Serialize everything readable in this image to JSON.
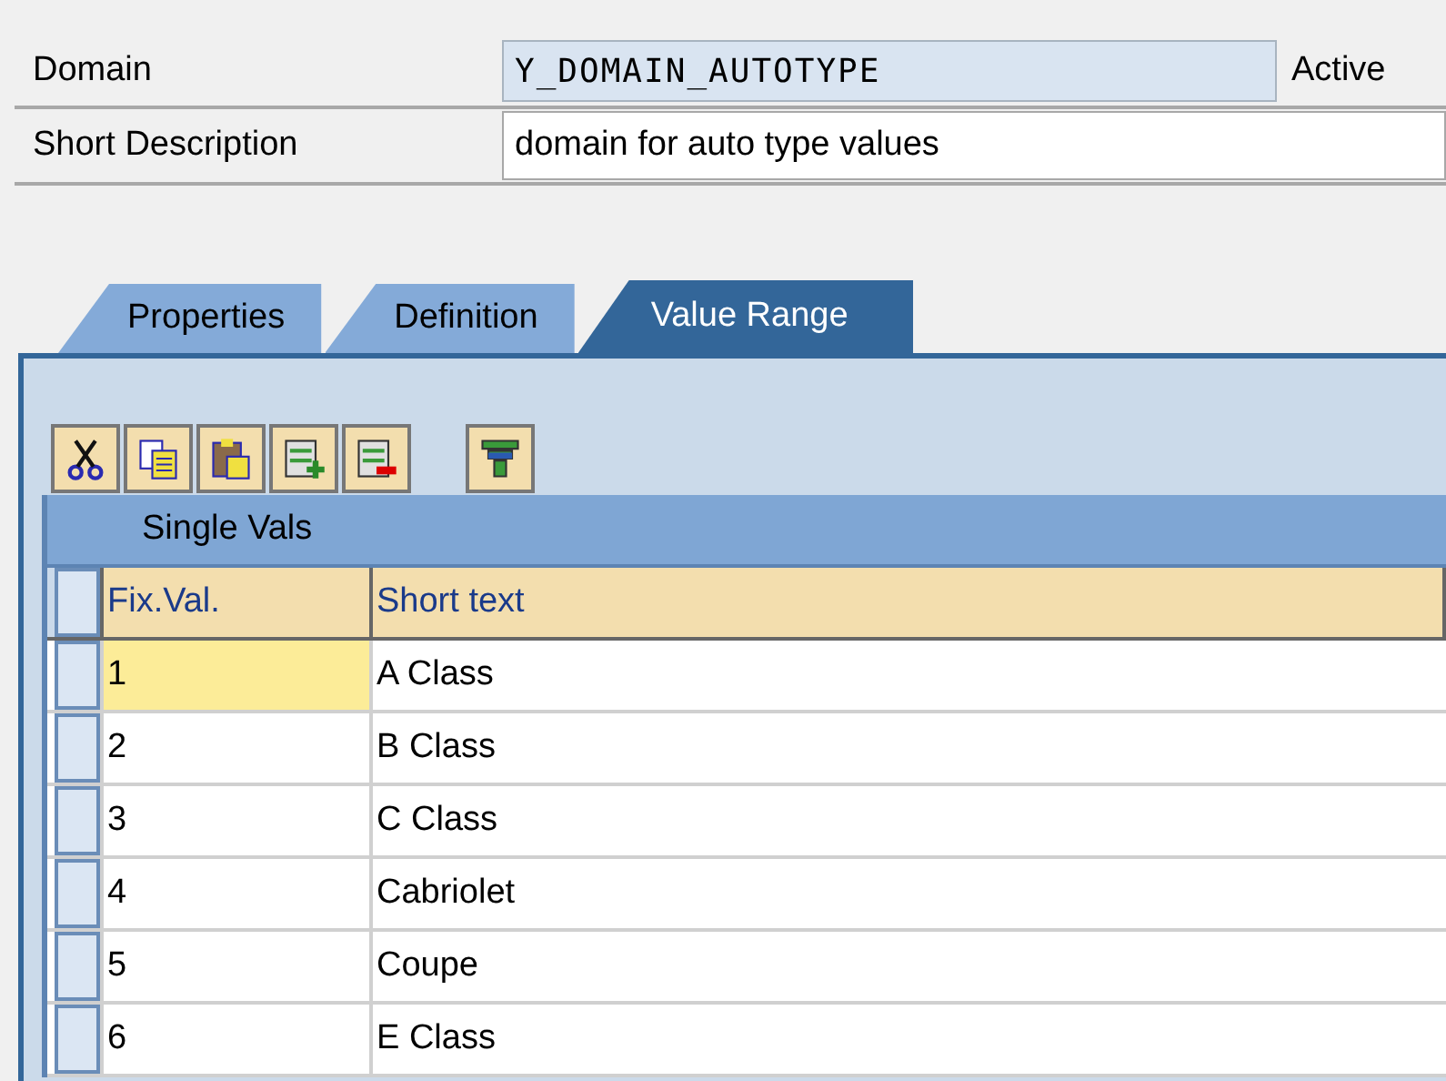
{
  "header": {
    "fields": [
      {
        "label": "Domain",
        "value": "Y_DOMAIN_AUTOTYPE",
        "kind": "readonly",
        "status": "Active"
      },
      {
        "label": "Short Description",
        "value": "domain for auto type values",
        "kind": "editable"
      }
    ]
  },
  "tabs": [
    {
      "label": "Properties",
      "selected": false
    },
    {
      "label": "Definition",
      "selected": false
    },
    {
      "label": "Value Range",
      "selected": true
    }
  ],
  "toolbar": {
    "buttons": [
      {
        "kind": "cut"
      },
      {
        "kind": "copy"
      },
      {
        "kind": "paste"
      },
      {
        "kind": "insert-row"
      },
      {
        "kind": "delete-row"
      },
      {
        "kind": "filter"
      }
    ]
  },
  "table": {
    "title": "Single Vals",
    "columns": [
      "Fix.Val.",
      "Short text"
    ],
    "rows": [
      {
        "cells": [
          "1",
          "A Class"
        ],
        "focused": true
      },
      {
        "cells": [
          "2",
          "B Class"
        ],
        "focused": false
      },
      {
        "cells": [
          "3",
          "C Class"
        ],
        "focused": false
      },
      {
        "cells": [
          "4",
          "Cabriolet"
        ],
        "focused": false
      },
      {
        "cells": [
          "5",
          "Coupe"
        ],
        "focused": false
      },
      {
        "cells": [
          "6",
          "E Class"
        ],
        "focused": false
      }
    ]
  }
}
